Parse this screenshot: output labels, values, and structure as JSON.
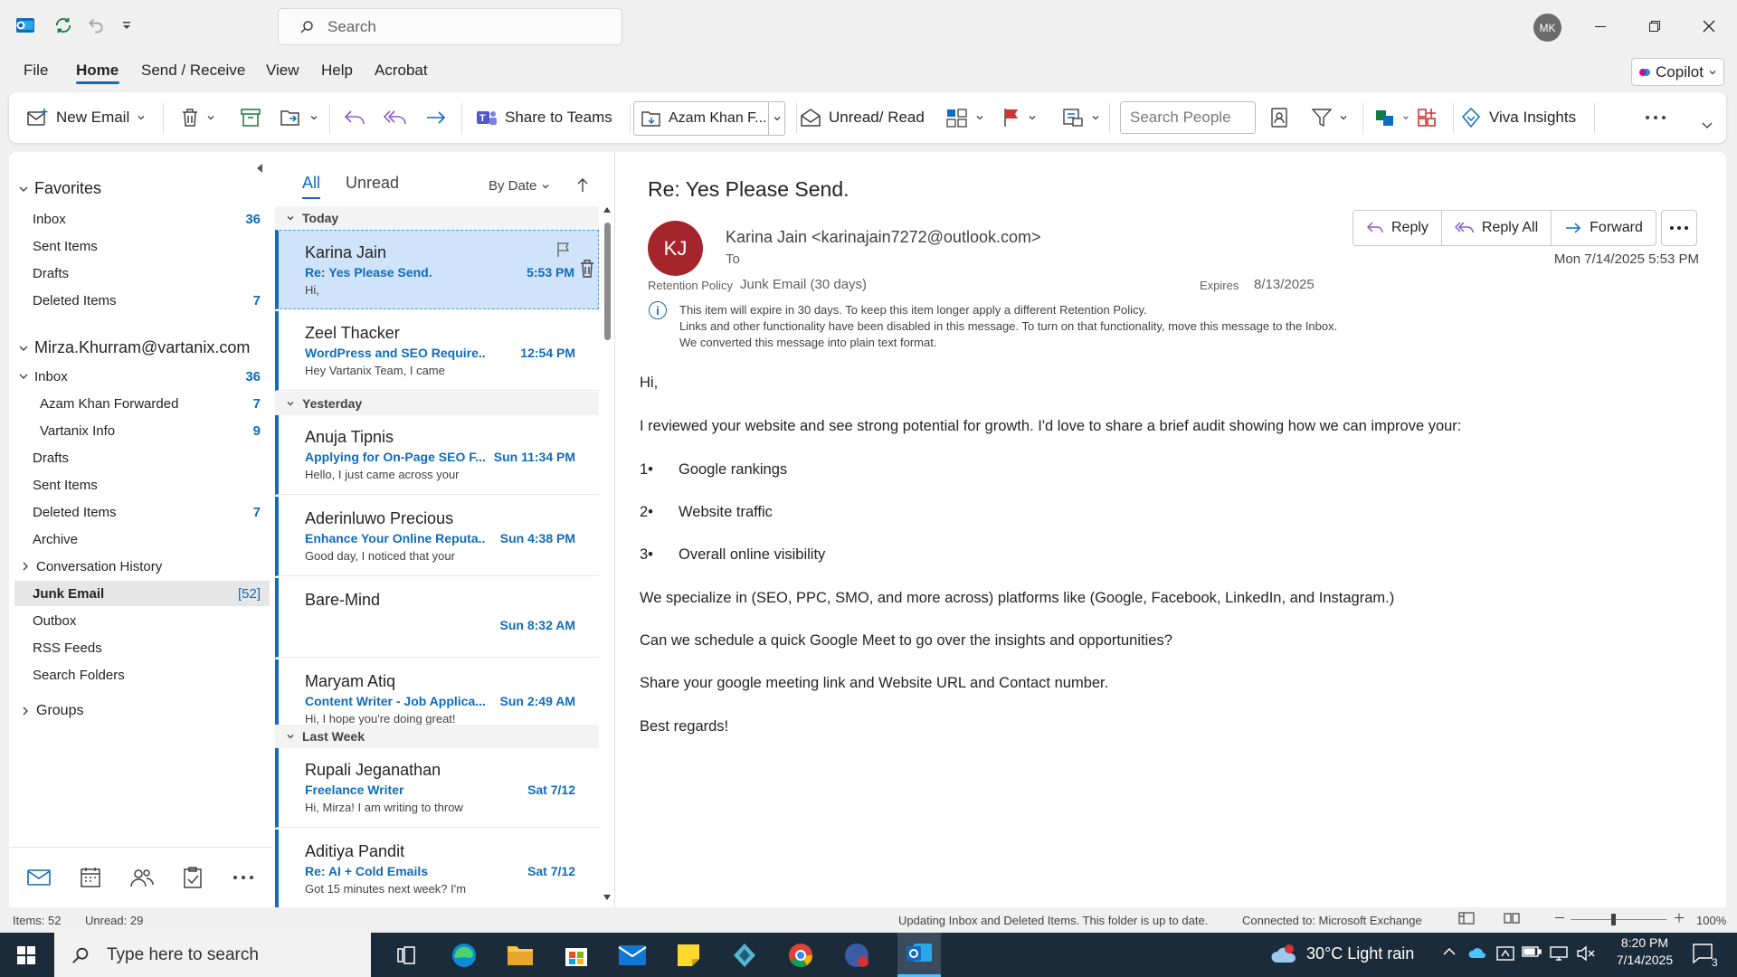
{
  "titlebar": {
    "search_placeholder": "Search",
    "avatar_initials": "MK"
  },
  "menu": {
    "items": [
      "File",
      "Home",
      "Send / Receive",
      "View",
      "Help",
      "Acrobat"
    ],
    "active": "Home",
    "copilot": "Copilot"
  },
  "ribbon": {
    "new_email": "New Email",
    "share_to_teams": "Share to Teams",
    "move_to": "Azam Khan F...",
    "unread_read": "Unread/ Read",
    "search_people_placeholder": "Search People",
    "viva_insights": "Viva Insights"
  },
  "folders": {
    "favorites_header": "Favorites",
    "favorites": [
      {
        "label": "Inbox",
        "count": "36"
      },
      {
        "label": "Sent Items",
        "count": ""
      },
      {
        "label": "Drafts",
        "count": ""
      },
      {
        "label": "Deleted Items",
        "count": "7"
      }
    ],
    "account_header": "Mirza.Khurram@vartanix.com",
    "inbox": {
      "label": "Inbox",
      "count": "36"
    },
    "inbox_sub": [
      {
        "label": "Azam Khan Forwarded",
        "count": "7"
      },
      {
        "label": "Vartanix Info",
        "count": "9"
      }
    ],
    "account_items": [
      {
        "label": "Drafts",
        "count": ""
      },
      {
        "label": "Sent Items",
        "count": ""
      },
      {
        "label": "Deleted Items",
        "count": "7"
      },
      {
        "label": "Archive",
        "count": ""
      }
    ],
    "conversation_history": "Conversation History",
    "junk": {
      "label": "Junk Email",
      "count": "[52]"
    },
    "after_junk": [
      "Outbox",
      "RSS Feeds",
      "Search Folders"
    ],
    "groups": "Groups"
  },
  "list": {
    "tab_all": "All",
    "tab_unread": "Unread",
    "sort_label": "By Date",
    "groups": {
      "today": "Today",
      "yesterday": "Yesterday",
      "last_week": "Last Week"
    },
    "messages": [
      {
        "sender": "Karina Jain",
        "subject": "Re: Yes Please Send.",
        "time": "5:53 PM",
        "preview": "Hi,"
      },
      {
        "sender": "Zeel Thacker",
        "subject": "WordPress and SEO Require...",
        "time": "12:54 PM",
        "preview": "Hey Vartanix Team,  I came"
      },
      {
        "sender": "Anuja Tipnis",
        "subject": "Applying for On-Page SEO F...",
        "time": "Sun 11:34 PM",
        "preview": "Hello,  I just came across your"
      },
      {
        "sender": "Aderinluwo Precious",
        "subject": "Enhance Your Online Reputa...",
        "time": "Sun 4:38 PM",
        "preview": "Good day,  I noticed that your"
      },
      {
        "sender": "Bare-Mind",
        "subject": "",
        "time": "Sun 8:32 AM",
        "preview": ""
      },
      {
        "sender": "Maryam Atiq",
        "subject": "Content Writer - Job Applica...",
        "time": "Sun 2:49 AM",
        "preview": "Hi,  I hope you're doing great!"
      },
      {
        "sender": "Rupali Jeganathan",
        "subject": "Freelance Writer",
        "time": "Sat 7/12",
        "preview": "Hi, Mirza!  I am writing to throw"
      },
      {
        "sender": "Aditiya Pandit",
        "subject": "Re: AI + Cold Emails",
        "time": "Sat 7/12",
        "preview": "Got 15 minutes next week? I'm"
      }
    ]
  },
  "reading": {
    "subject": "Re: Yes Please Send.",
    "avatar_initials": "KJ",
    "from": "Karina Jain <karinajain7272@outlook.com>",
    "to_label": "To",
    "reply": "Reply",
    "reply_all": "Reply All",
    "forward": "Forward",
    "date": "Mon 7/14/2025 5:53 PM",
    "retention_label": "Retention Policy",
    "retention_value": "Junk Email (30 days)",
    "expires_label": "Expires",
    "expires_value": "8/13/2025",
    "info_lines": [
      "This item will expire in 30 days. To keep this item longer apply a different Retention Policy.",
      "Links and other functionality have been disabled in this message. To turn on that functionality, move this message to the Inbox.",
      "We converted this message into plain text format."
    ],
    "body": {
      "greeting": "Hi,",
      "intro": "I reviewed your website and see strong potential for growth. I'd love to share a brief audit showing how we can improve your:",
      "points": [
        {
          "num": "1•",
          "text": "Google rankings"
        },
        {
          "num": "2•",
          "text": "Website traffic"
        },
        {
          "num": "3•",
          "text": "Overall online visibility"
        }
      ],
      "specialize": "We specialize in (SEO, PPC, SMO, and more across) platforms like (Google, Facebook, LinkedIn, and Instagram.)",
      "schedule": "Can we schedule a quick Google Meet to go over the insights and opportunities?",
      "share": "Share your google meeting link and Website URL and Contact number.",
      "closing": "Best regards!"
    }
  },
  "status": {
    "items": "Items: 52",
    "unread": "Unread: 29",
    "updating": "Updating Inbox and Deleted Items.  This folder is up to date.",
    "connected": "Connected to: Microsoft Exchange",
    "zoom": "100%"
  },
  "taskbar": {
    "search_placeholder": "Type here to search",
    "weather": "30°C  Light rain",
    "time": "8:20 PM",
    "date": "7/14/2025",
    "notifications": "3"
  },
  "colors": {
    "accent": "#0f6cbd",
    "sender_avatar": "#a4262c",
    "taskbar": "#1c2b3a"
  }
}
